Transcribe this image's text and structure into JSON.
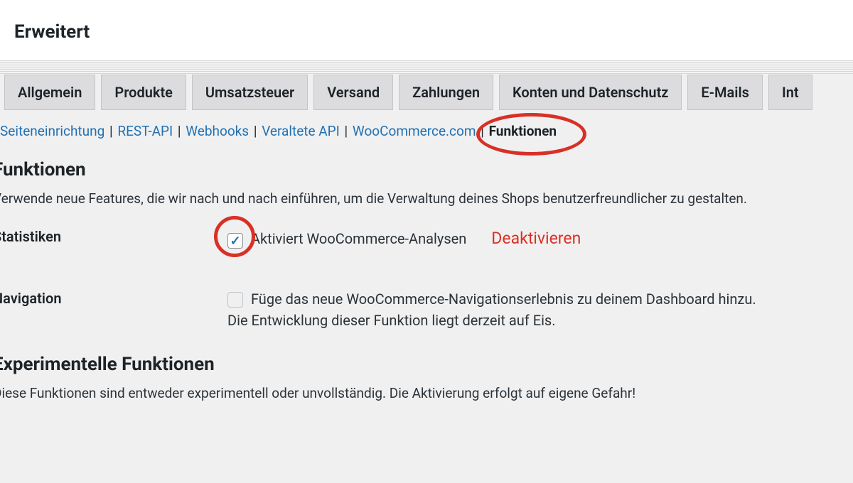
{
  "header": {
    "title": "Erweitert"
  },
  "tabs": [
    "Allgemein",
    "Produkte",
    "Umsatzsteuer",
    "Versand",
    "Zahlungen",
    "Konten und Datenschutz",
    "E-Mails",
    "Int"
  ],
  "subnav": {
    "items": [
      "Seiteneinrichtung",
      "REST-API",
      "Webhooks",
      "Veraltete API",
      "WooCommerce.com"
    ],
    "active": "Funktionen"
  },
  "section1": {
    "title": "Funktionen",
    "desc": "Verwende neue Features, die wir nach und nach einführen, um die Verwaltung deines Shops benutzerfreundlicher zu gestalten."
  },
  "stats": {
    "label": "Statistiken",
    "checkbox_label": "Aktiviert WooCommerce-Analysen",
    "annotation": "Deaktivieren"
  },
  "nav": {
    "label": "Navigation",
    "checkbox_label": "Füge das neue WooCommerce-Navigationserlebnis zu deinem Dashboard hinzu. Die Entwicklung dieser Funktion liegt derzeit auf Eis."
  },
  "section2": {
    "title": "Experimentelle Funktionen",
    "desc": "Diese Funktionen sind entweder experimentell oder unvollständig. Die Aktivierung erfolgt auf eigene Gefahr!"
  }
}
